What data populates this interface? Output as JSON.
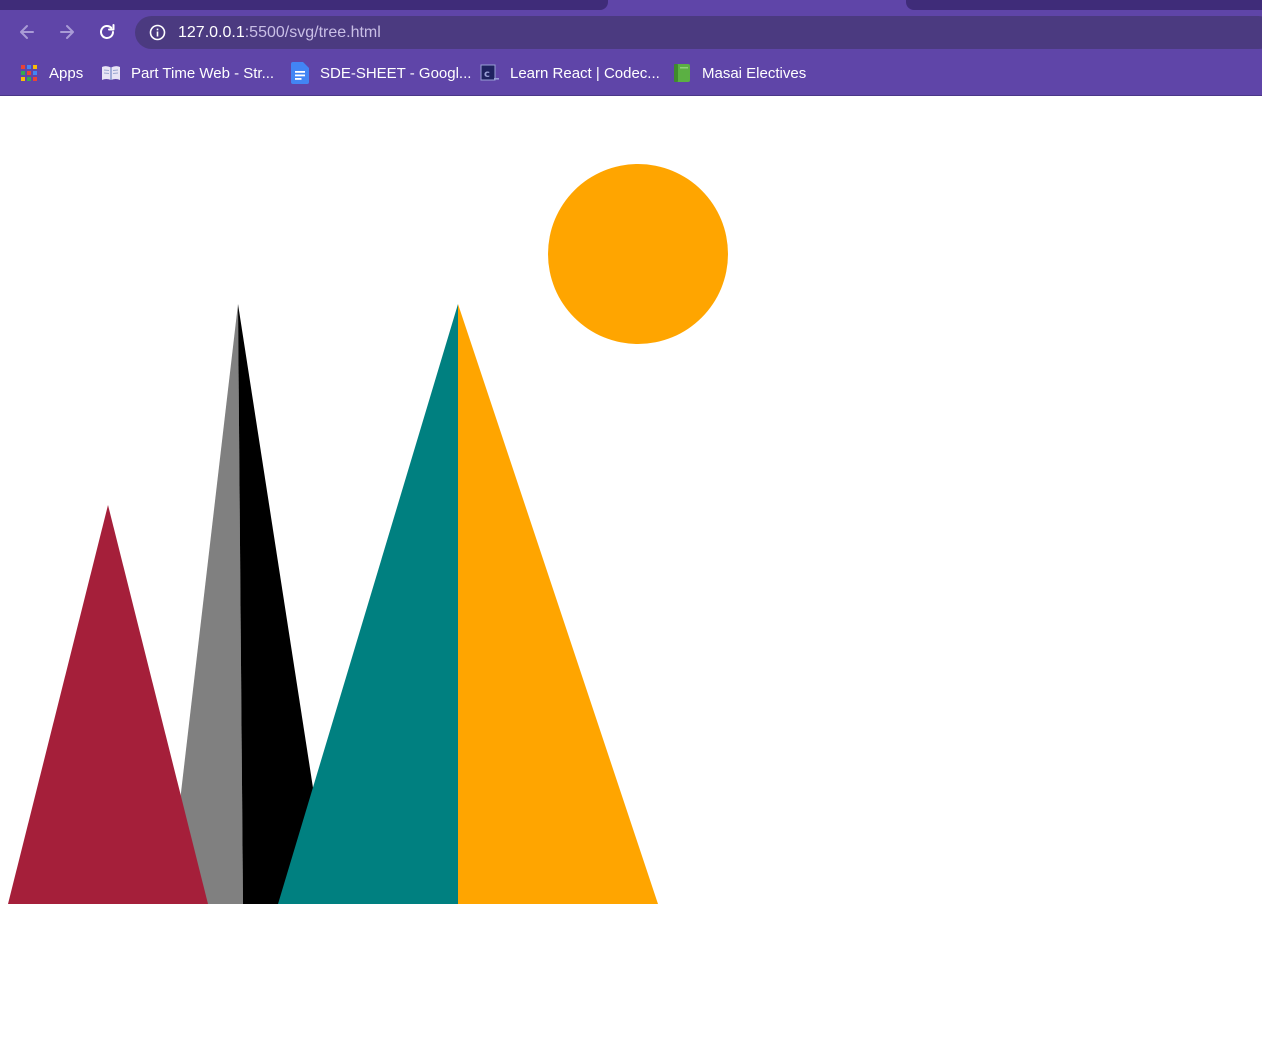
{
  "browser": {
    "url_host": "127.0.0.1",
    "url_path": ":5500/svg/tree.html",
    "theme_color": "#5f45a8",
    "buttons": {
      "back": "arrow-left-icon",
      "forward": "arrow-right-icon",
      "reload": "reload-icon",
      "site_info": "info-icon"
    }
  },
  "bookmarks": [
    {
      "label": "Apps",
      "icon": "apps-grid-icon"
    },
    {
      "label": "Part Time Web - Str...",
      "icon": "book-icon"
    },
    {
      "label": "SDE-SHEET - Googl...",
      "icon": "google-docs-icon"
    },
    {
      "label": "Learn React | Codec...",
      "icon": "codecademy-icon"
    },
    {
      "label": "Masai Electives",
      "icon": "green-book-icon"
    }
  ],
  "scene": {
    "colors": {
      "sun": "#ffa500",
      "crimson_peak": "#a51f3a",
      "gray_peak_left": "#808080",
      "gray_peak_right": "#000000",
      "teal_peak_left": "#008080",
      "teal_peak_right": "#ffa500"
    }
  }
}
